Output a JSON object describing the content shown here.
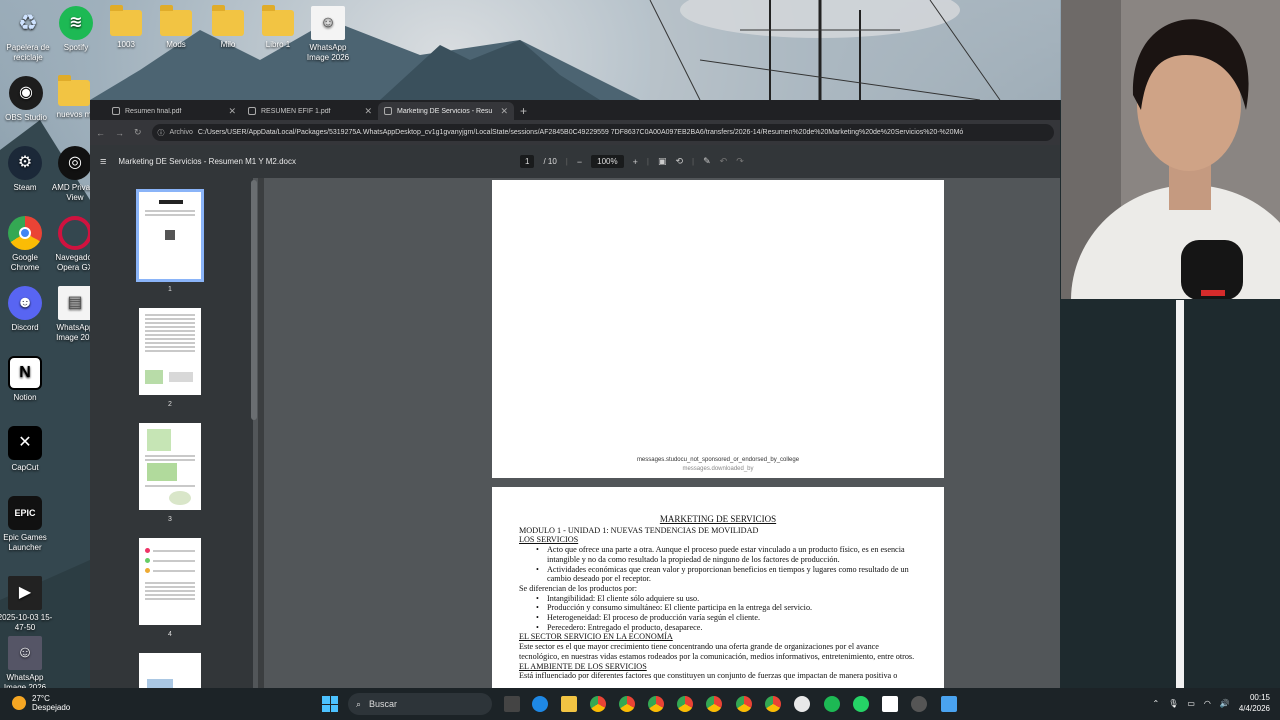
{
  "desktop": {
    "icons_left": [
      {
        "label": "Papelera de reciclaje",
        "icon": "recycle-bin-icon"
      },
      {
        "label": "Spotify",
        "icon": "spotify-icon"
      },
      {
        "label": "1003",
        "icon": "folder-icon"
      },
      {
        "label": "Mods",
        "icon": "folder-icon"
      },
      {
        "label": "Milo",
        "icon": "folder-icon"
      },
      {
        "label": "Libro 1",
        "icon": "folder-icon"
      },
      {
        "label": "WhatsApp Image 2026",
        "icon": "image-file-icon"
      },
      {
        "label": "OBS Studio",
        "icon": "obs-icon"
      },
      {
        "label": "nuevos m",
        "icon": "folder-icon"
      },
      {
        "label": "Steam",
        "icon": "steam-icon"
      },
      {
        "label": "AMD Privacy View",
        "icon": "amd-icon"
      },
      {
        "label": "Google Chrome",
        "icon": "chrome-icon"
      },
      {
        "label": "Navegador Opera GX",
        "icon": "opera-icon"
      },
      {
        "label": "Discord",
        "icon": "discord-icon"
      },
      {
        "label": "WhatsApp Image 202",
        "icon": "image-file-icon"
      },
      {
        "label": "Notion",
        "icon": "notion-icon"
      },
      {
        "label": "CapCut",
        "icon": "capcut-icon"
      },
      {
        "label": "Epic Games Launcher",
        "icon": "epic-games-icon"
      },
      {
        "label": "2025-10-03 15-47-50",
        "icon": "video-file-icon"
      },
      {
        "label": "WhatsApp Image 2026",
        "icon": "image-file-icon"
      }
    ]
  },
  "browser": {
    "tabs": [
      {
        "title": "Resumen final.pdf",
        "active": false
      },
      {
        "title": "RESUMEN EFIF 1.pdf",
        "active": false
      },
      {
        "title": "Marketing DE Servicios - Resu",
        "active": true
      }
    ],
    "address": {
      "chip": "Archivo",
      "url": "C:/Users/USER/AppData/Local/Packages/5319275A.WhatsAppDesktop_cv1g1gvanyjgm/LocalState/sessions/AF2845B0C49229559 7DF8637C0A00A097EB2BA6/transfers/2026-14/Resumen%20de%20Marketing%20de%20Servicios%20-%20Mó"
    },
    "pdf": {
      "title": "Marketing DE Servicios - Resumen M1 Y M2.docx",
      "current_page": "1",
      "total_pages": "/ 10",
      "zoom": "100%",
      "thumbnails": [
        "1",
        "2",
        "3",
        "4"
      ],
      "page1_footer": "messages.studocu_not_sponsored_or_endorsed_by_college",
      "page1_footer2": "messages.downloaded_by",
      "page2": {
        "heading": "MARKETING DE SERVICIOS",
        "module": "MODULO 1 - UNIDAD 1: NUEVAS TENDENCIAS DE MOVILIDAD",
        "section1": "LOS SERVICIOS",
        "bullets1": [
          "Acto que ofrece una parte a otra. Aunque el proceso puede estar vinculado a un producto físico, es en esencia intangible y no da como resultado la propiedad de ninguno de los factores de producción.",
          "Actividades económicas que crean valor y proporcionan beneficios en tiempos y lugares como resultado de un cambio deseado por el receptor."
        ],
        "diff_intro": "Se diferencian de los productos por:",
        "bullets2": [
          "Intangibilidad: El cliente sólo adquiere su uso.",
          "Producción y consumo simultáneo: El cliente participa en la entrega del servicio.",
          "Heterogeneidad: El proceso de producción varía según el cliente.",
          "Perecedero: Entregado el producto, desaparece."
        ],
        "section2": "EL SECTOR SERVICIO EN LA ECONOMÍA",
        "para2": "Este sector es el que mayor crecimiento tiene concentrando una oferta grande de organizaciones por el avance tecnológico, en nuestras vidas estamos rodeados por la comunicación, medios informativos, entretenimiento, entre otros.",
        "section3": "EL AMBIENTE DE LOS SERVICIOS",
        "para3": "Está influenciado por diferentes factores que constituyen un conjunto de fuerzas que impactan de manera positiva o"
      }
    }
  },
  "taskbar": {
    "weather_temp": "27°C",
    "weather_desc": "Despejado",
    "search_placeholder": "Buscar",
    "time": "00:15",
    "date": "4/4/2026"
  }
}
